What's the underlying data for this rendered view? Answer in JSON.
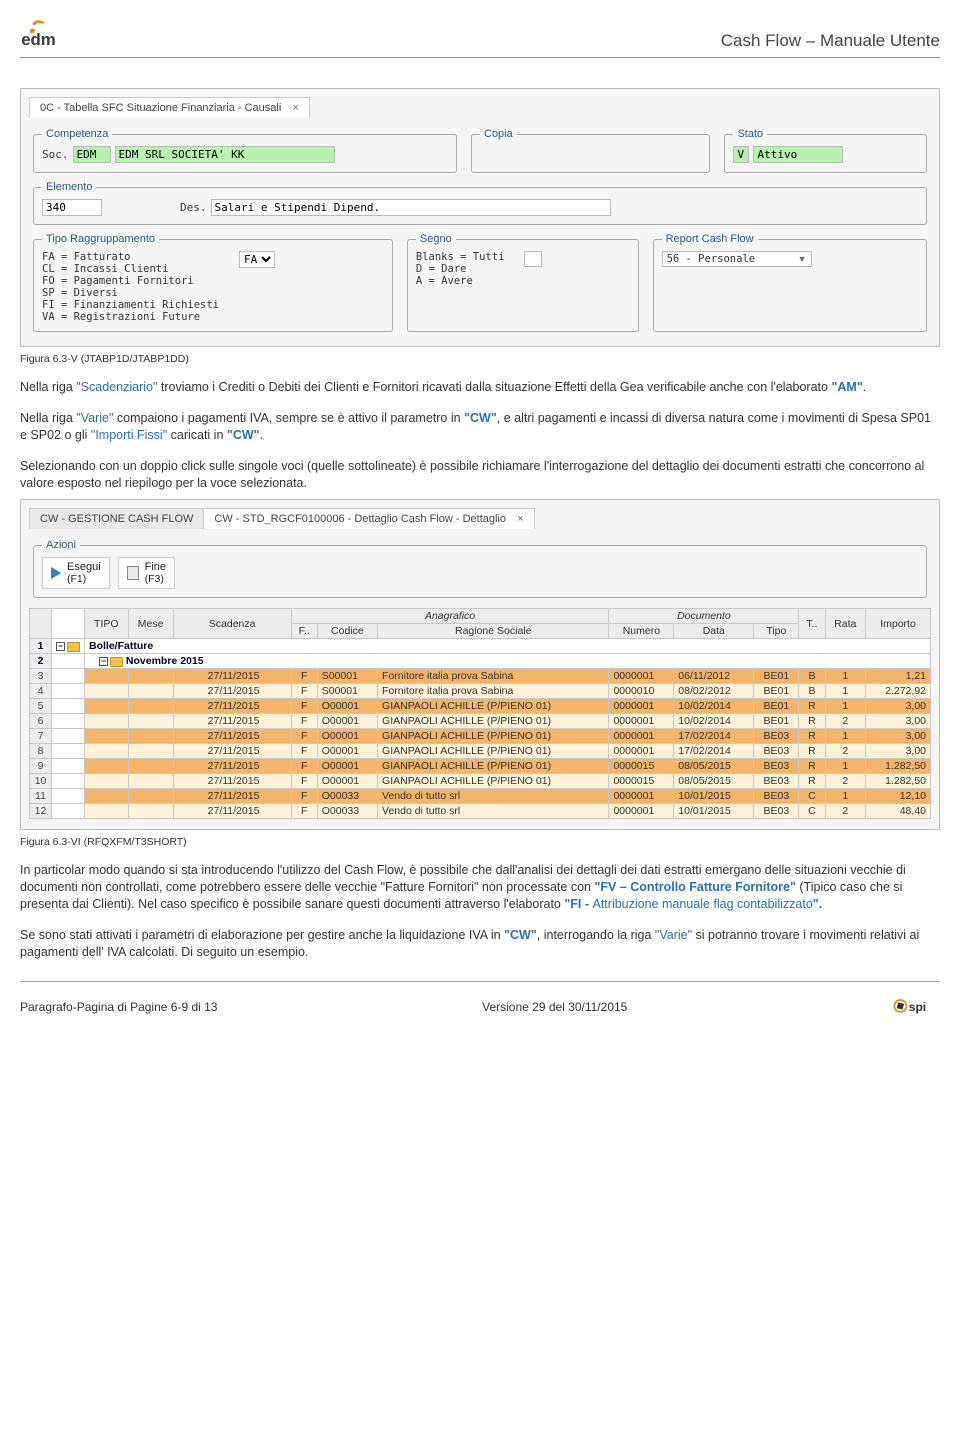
{
  "header": {
    "doc_title": "Cash Flow – Manuale Utente"
  },
  "footer": {
    "left": "Paragrafo-Pagina di Pagine 6-9 di 13",
    "center": "Versione 29 del 30/11/2015"
  },
  "fig1": {
    "tab_title": "0C - Tabella SFC Situazione Finanziaria - Causali",
    "competenza_legend": "Competenza",
    "soc_label": "Soc.",
    "soc_code": "EDM",
    "soc_desc": "EDM SRL SOCIETA' KK",
    "copia_legend": "Copia",
    "stato_legend": "Stato",
    "stato_code": "V",
    "stato_desc": "Attivo",
    "elemento_legend": "Elemento",
    "elemento_code": "340",
    "elemento_des_label": "Des.",
    "elemento_des": "Salari e Stipendi Dipend.",
    "tipo_legend": "Tipo Raggruppamento",
    "tipo_lines": [
      "FA = Fatturato",
      "CL = Incassi Clienti",
      "FO = Pagamenti Fornitori",
      "SP = Diversi",
      "FI = Finanziamenti Richiesti",
      "VA = Registrazioni Future"
    ],
    "tipo_sel": "FA",
    "segno_legend": "Segno",
    "segno_lines": [
      "Blanks = Tutti",
      "D = Dare",
      "A = Avere"
    ],
    "rcf_legend": "Report Cash Flow",
    "rcf_value": "56 - Personale",
    "caption": "Figura 6.3-V  (JTABP1D/JTABP1DD)"
  },
  "para1": {
    "before_q1": "Nella riga ",
    "q1": "\"Scadenziario\"",
    "after_q1": " troviamo i Crediti o Debiti dei Clienti e Fornitori ricavati dalla situazione Effetti della Gea  verificabile anche con l'elaborato ",
    "q2": "\"AM\"",
    "tail": "."
  },
  "para2": {
    "t1": "Nella riga ",
    "varie": "\"Varie\"",
    "t2": " compaiono i pagamenti IVA, sempre se è attivo il parametro in ",
    "cw1": "\"CW\"",
    "t3": ", e altri pagamenti e incassi di diversa natura  come i movimenti di Spesa SP01 e SP02 o gli ",
    "importi": "\"Importi Fissi\"",
    "t4": " caricati in ",
    "cw2": "\"CW\"",
    "tail": "."
  },
  "para3": "Selezionando con un doppio click sulle singole voci (quelle sottolineate) è possibile richiamare l'interrogazione del dettaglio dei documenti estratti che concorrono al valore esposto nel riepilogo per la voce selezionata.",
  "fig2": {
    "tabs": [
      "CW - GESTIONE CASH FLOW",
      "CW - STD_RGCF0100006 - Dettaglio Cash Flow - Dettaglio"
    ],
    "azioni_legend": "Azioni",
    "btn_esegui": "Esegui",
    "btn_esegui_sub": "(F1)",
    "btn_fine": "Fine",
    "btn_fine_sub": "(F3)",
    "group_anag": "Anagrafico",
    "group_doc": "Documento",
    "cols": {
      "tipo": "TIPO",
      "mese": "Mese",
      "scad": "Scadenza",
      "f": "F..",
      "codice": "Codice",
      "rags": "Ragione Sociale",
      "numero": "Numero",
      "data": "Data",
      "dtipo": "Tipo",
      "t": "T..",
      "rata": "Rata",
      "importo": "Importo"
    },
    "folder1": "Bolle/Fatture",
    "folder2": "Novembre 2015",
    "rows": [
      {
        "n": "3",
        "scad": "27/11/2015",
        "f": "F",
        "cod": "S00001",
        "rag": "Fornitore italia prova Sabina",
        "num": "0000001",
        "data": "06/11/2012",
        "tp": "BE01",
        "t": "B",
        "rata": "1",
        "imp": "1,21",
        "cls": "orange"
      },
      {
        "n": "4",
        "scad": "27/11/2015",
        "f": "F",
        "cod": "S00001",
        "rag": "Fornitore italia prova Sabina",
        "num": "0000010",
        "data": "08/02/2012",
        "tp": "BE01",
        "t": "B",
        "rata": "1",
        "imp": "2.272,92",
        "cls": "pale"
      },
      {
        "n": "5",
        "scad": "27/11/2015",
        "f": "F",
        "cod": "O00001",
        "rag": "GIANPAOLI ACHILLE (P/PIENO 01)",
        "num": "0000001",
        "data": "10/02/2014",
        "tp": "BE01",
        "t": "R",
        "rata": "1",
        "imp": "3,00",
        "cls": "orange"
      },
      {
        "n": "6",
        "scad": "27/11/2015",
        "f": "F",
        "cod": "O00001",
        "rag": "GIANPAOLI ACHILLE (P/PIENO 01)",
        "num": "0000001",
        "data": "10/02/2014",
        "tp": "BE01",
        "t": "R",
        "rata": "2",
        "imp": "3,00",
        "cls": "pale"
      },
      {
        "n": "7",
        "scad": "27/11/2015",
        "f": "F",
        "cod": "O00001",
        "rag": "GIANPAOLI ACHILLE (P/PIENO 01)",
        "num": "0000001",
        "data": "17/02/2014",
        "tp": "BE03",
        "t": "R",
        "rata": "1",
        "imp": "3,00",
        "cls": "orange"
      },
      {
        "n": "8",
        "scad": "27/11/2015",
        "f": "F",
        "cod": "O00001",
        "rag": "GIANPAOLI ACHILLE (P/PIENO 01)",
        "num": "0000001",
        "data": "17/02/2014",
        "tp": "BE03",
        "t": "R",
        "rata": "2",
        "imp": "3,00",
        "cls": "pale"
      },
      {
        "n": "9",
        "scad": "27/11/2015",
        "f": "F",
        "cod": "O00001",
        "rag": "GIANPAOLI ACHILLE (P/PIENO 01)",
        "num": "0000015",
        "data": "08/05/2015",
        "tp": "BE03",
        "t": "R",
        "rata": "1",
        "imp": "1.282,50",
        "cls": "orange"
      },
      {
        "n": "10",
        "scad": "27/11/2015",
        "f": "F",
        "cod": "O00001",
        "rag": "GIANPAOLI ACHILLE (P/PIENO 01)",
        "num": "0000015",
        "data": "08/05/2015",
        "tp": "BE03",
        "t": "R",
        "rata": "2",
        "imp": "1.282,50",
        "cls": "pale"
      },
      {
        "n": "11",
        "scad": "27/11/2015",
        "f": "F",
        "cod": "O00033",
        "rag": "Vendo di tutto srl",
        "num": "0000001",
        "data": "10/01/2015",
        "tp": "BE03",
        "t": "C",
        "rata": "1",
        "imp": "12,10",
        "cls": "orange"
      },
      {
        "n": "12",
        "scad": "27/11/2015",
        "f": "F",
        "cod": "O00033",
        "rag": "Vendo di tutto srl",
        "num": "0000001",
        "data": "10/01/2015",
        "tp": "BE03",
        "t": "C",
        "rata": "2",
        "imp": "48,40",
        "cls": "pale"
      }
    ],
    "caption": "Figura 6.3-VI  (RFQXFM/T3SHORT)"
  },
  "para4": {
    "t1": "In particolar modo quando si sta introducendo l'utilizzo del Cash Flow, è possibile che dall'analisi dei dettagli dei dati estratti emergano delle situazioni vecchie di documenti non controllati, come potrebbero essere delle vecchie \"Fatture Fornitori\" non processate con ",
    "fv": "\"FV – Controllo Fatture Fornitore\"",
    "t2": " (Tipico caso che si presenta dai Clienti).  Nel caso specifico è possibile sanare questi documenti attraverso  l'elaborato ",
    "fi": "\"FI - ",
    "fi2": "Attribuzione manuale flag contabilizzato",
    "fi3": "\".",
    "dot": ""
  },
  "para5": {
    "t1": "Se sono stati attivati i parametri di elaborazione per gestire anche la liquidazione IVA in ",
    "cw": "\"CW\"",
    "t2": ", interrogando la riga ",
    "varie": "\"Varie\"",
    "t3": " si potranno trovare  i movimenti  relativi ai pagamenti dell' IVA calcolati.  Di seguito un esempio."
  }
}
